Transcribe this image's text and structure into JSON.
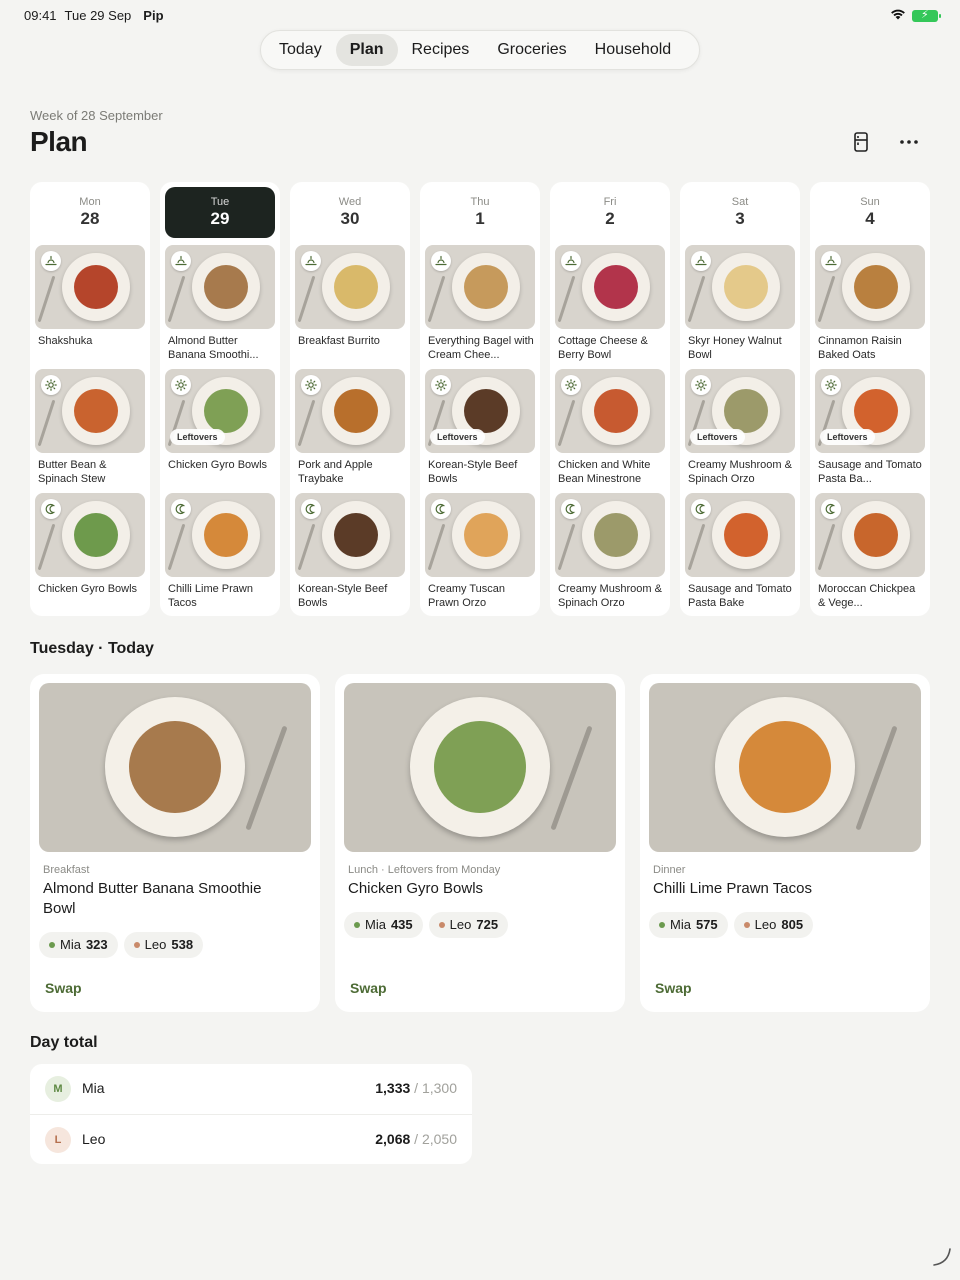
{
  "status_bar": {
    "time": "09:41",
    "date": "Tue 29 Sep",
    "app": "Pip"
  },
  "nav": {
    "tabs": [
      "Today",
      "Plan",
      "Recipes",
      "Groceries",
      "Household"
    ],
    "active": "Plan"
  },
  "header": {
    "week_label": "Week of 28 September",
    "title": "Plan"
  },
  "colors": {
    "accent_green": "#4d6b35",
    "today_dark": "#1d2420",
    "mia_dot": "#6b9a4e",
    "leo_dot": "#c98a6a"
  },
  "week": [
    {
      "day": "Mon",
      "date": "28",
      "today": false,
      "meals": [
        {
          "slot": "breakfast",
          "name": "Shakshuka",
          "leftovers": false,
          "food": "#b5452b"
        },
        {
          "slot": "lunch",
          "name": "Butter Bean & Spinach Stew",
          "leftovers": false,
          "food": "#c9632f"
        },
        {
          "slot": "dinner",
          "name": "Chicken Gyro Bowls",
          "leftovers": false,
          "food": "#6e9a4c"
        }
      ]
    },
    {
      "day": "Tue",
      "date": "29",
      "today": true,
      "meals": [
        {
          "slot": "breakfast",
          "name": "Almond Butter Banana Smoothi...",
          "leftovers": false,
          "food": "#a77a4d"
        },
        {
          "slot": "lunch",
          "name": "Chicken Gyro Bowls",
          "leftovers": true,
          "leftovers_label": "Leftovers",
          "food": "#7fa055"
        },
        {
          "slot": "dinner",
          "name": "Chilli Lime Prawn Tacos",
          "leftovers": false,
          "food": "#d5893a"
        }
      ]
    },
    {
      "day": "Wed",
      "date": "30",
      "today": false,
      "meals": [
        {
          "slot": "breakfast",
          "name": "Breakfast Burrito",
          "leftovers": false,
          "food": "#d9b96a"
        },
        {
          "slot": "lunch",
          "name": "Pork and Apple Traybake",
          "leftovers": false,
          "food": "#b86f2c"
        },
        {
          "slot": "dinner",
          "name": "Korean-Style Beef Bowls",
          "leftovers": false,
          "food": "#5b3b27"
        }
      ]
    },
    {
      "day": "Thu",
      "date": "1",
      "today": false,
      "meals": [
        {
          "slot": "breakfast",
          "name": "Everything Bagel with Cream Chee...",
          "leftovers": false,
          "food": "#c69a5c"
        },
        {
          "slot": "lunch",
          "name": "Korean-Style Beef Bowls",
          "leftovers": true,
          "leftovers_label": "Leftovers",
          "food": "#5b3b27"
        },
        {
          "slot": "dinner",
          "name": "Creamy Tuscan Prawn Orzo",
          "leftovers": false,
          "food": "#e0a45a"
        }
      ]
    },
    {
      "day": "Fri",
      "date": "2",
      "today": false,
      "meals": [
        {
          "slot": "breakfast",
          "name": "Cottage Cheese & Berry Bowl",
          "leftovers": false,
          "food": "#b2344b"
        },
        {
          "slot": "lunch",
          "name": "Chicken and White Bean Minestrone",
          "leftovers": false,
          "food": "#c75a30"
        },
        {
          "slot": "dinner",
          "name": "Creamy Mushroom & Spinach Orzo",
          "leftovers": false,
          "food": "#9c9a6a"
        }
      ]
    },
    {
      "day": "Sat",
      "date": "3",
      "today": false,
      "meals": [
        {
          "slot": "breakfast",
          "name": "Skyr Honey Walnut Bowl",
          "leftovers": false,
          "food": "#e4c98a"
        },
        {
          "slot": "lunch",
          "name": "Creamy Mushroom & Spinach Orzo",
          "leftovers": true,
          "leftovers_label": "Leftovers",
          "food": "#9c9a6a"
        },
        {
          "slot": "dinner",
          "name": "Sausage and Tomato Pasta Bake",
          "leftovers": false,
          "food": "#d2622d"
        }
      ]
    },
    {
      "day": "Sun",
      "date": "4",
      "today": false,
      "meals": [
        {
          "slot": "breakfast",
          "name": "Cinnamon Raisin Baked Oats",
          "leftovers": false,
          "food": "#b9803f"
        },
        {
          "slot": "lunch",
          "name": "Sausage and Tomato Pasta Ba...",
          "leftovers": true,
          "leftovers_label": "Leftovers",
          "food": "#d2622d"
        },
        {
          "slot": "dinner",
          "name": "Moroccan Chickpea & Vege...",
          "leftovers": false,
          "food": "#c8662c"
        }
      ]
    }
  ],
  "today": {
    "title": "Tuesday · Today",
    "cards": [
      {
        "kind": "Breakfast",
        "name": "Almond Butter Banana Smoothie Bowl",
        "food": "#a77a4d",
        "pills": [
          {
            "person": "Mia",
            "kcal": "323"
          },
          {
            "person": "Leo",
            "kcal": "538"
          }
        ],
        "swap": "Swap"
      },
      {
        "kind": "Lunch · Leftovers from Monday",
        "name": "Chicken Gyro Bowls",
        "food": "#7fa055",
        "pills": [
          {
            "person": "Mia",
            "kcal": "435"
          },
          {
            "person": "Leo",
            "kcal": "725"
          }
        ],
        "swap": "Swap"
      },
      {
        "kind": "Dinner",
        "name": "Chilli Lime Prawn Tacos",
        "food": "#d5893a",
        "pills": [
          {
            "person": "Mia",
            "kcal": "575"
          },
          {
            "person": "Leo",
            "kcal": "805"
          }
        ],
        "swap": "Swap"
      }
    ]
  },
  "totals": {
    "title": "Day total",
    "rows": [
      {
        "initial": "M",
        "name": "Mia",
        "value": "1,333",
        "separator": "/",
        "goal": "1,300"
      },
      {
        "initial": "L",
        "name": "Leo",
        "value": "2,068",
        "separator": "/",
        "goal": "2,050"
      }
    ]
  }
}
